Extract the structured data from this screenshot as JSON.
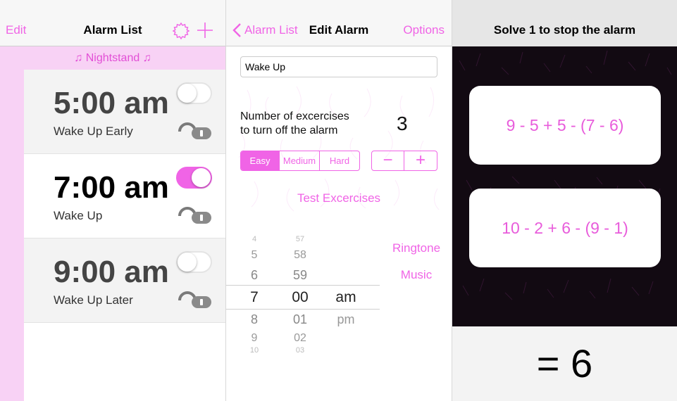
{
  "alarm_list": {
    "nav": {
      "left": "Edit",
      "title": "Alarm List"
    },
    "section": "♫ Nightstand ♫",
    "alarms": [
      {
        "time": "5:00 am",
        "label": "Wake Up Early",
        "enabled": false
      },
      {
        "time": "7:00 am",
        "label": "Wake Up",
        "enabled": true
      },
      {
        "time": "9:00 am",
        "label": "Wake Up Later",
        "enabled": false
      }
    ]
  },
  "edit_alarm": {
    "nav": {
      "back": "Alarm List",
      "title": "Edit Alarm",
      "right": "Options"
    },
    "name_value": "Wake Up",
    "exercises_label_line1": "Number of excercises",
    "exercises_label_line2": "to turn off the alarm",
    "exercises_count": "3",
    "difficulty": [
      "Easy",
      "Medium",
      "Hard"
    ],
    "difficulty_selected": "Easy",
    "stepper": {
      "minus": "−",
      "plus": "+"
    },
    "test_exercises": "Test Excercises",
    "picker": {
      "hours": [
        "4",
        "5",
        "6",
        "7",
        "8",
        "9",
        "10"
      ],
      "minutes": [
        "57",
        "58",
        "59",
        "00",
        "01",
        "02",
        "03"
      ],
      "ampm": [
        "am",
        "pm"
      ],
      "selected": {
        "hour": "7",
        "minute": "00",
        "ampm": "am"
      }
    },
    "ringtone": "Ringtone",
    "music": "Music"
  },
  "challenge": {
    "title": "Solve 1 to stop the alarm",
    "options": [
      "9 - 5 + 5 - (7 - 6)",
      "10 - 2 + 6 - (9 - 1)"
    ],
    "answer": "= 6"
  },
  "colors": {
    "accent": "#f064e6",
    "section_bg": "#f8d2f5"
  }
}
